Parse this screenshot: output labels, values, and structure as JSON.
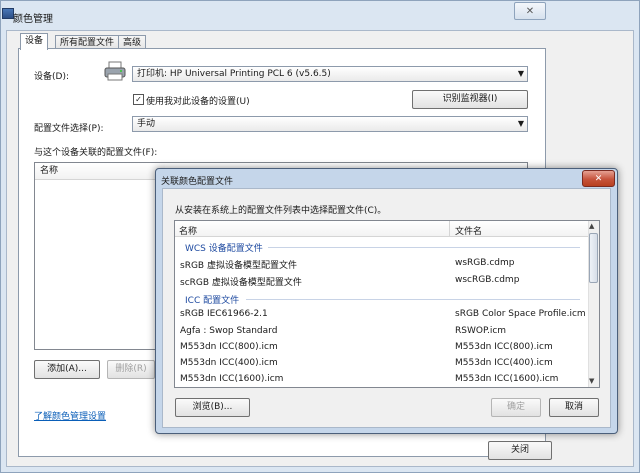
{
  "main": {
    "title": "颜色管理",
    "close_glyph": "✕",
    "tabs": [
      "设备",
      "所有配置文件",
      "高级"
    ],
    "device_label": "设备(D):",
    "device_value": "打印机: HP Universal Printing PCL 6 (v5.6.5)",
    "use_settings_checkbox": "使用我对此设备的设置(U)",
    "identify_button": "识别监视器(I)",
    "profile_selection_label": "配置文件选择(P):",
    "profile_selection_value": "手动",
    "associated_label": "与这个设备关联的配置文件(F):",
    "list_column_name": "名称",
    "add_button": "添加(A)...",
    "remove_button": "删除(R)",
    "learn_link": "了解颜色管理设置",
    "close_button": "关闭"
  },
  "dialog": {
    "title": "关联颜色配置文件",
    "close_glyph": "✕",
    "instruction": "从安装在系统上的配置文件列表中选择配置文件(C)。",
    "col_name": "名称",
    "col_file": "文件名",
    "wcs_group": "WCS 设备配置文件",
    "icc_group": "ICC 配置文件",
    "wcs_rows": [
      {
        "name": "sRGB 虚拟设备模型配置文件",
        "file": "wsRGB.cdmp"
      },
      {
        "name": "scRGB 虚拟设备模型配置文件",
        "file": "wscRGB.cdmp"
      }
    ],
    "icc_rows": [
      {
        "name": "sRGB IEC61966-2.1",
        "file": "sRGB Color Space Profile.icm"
      },
      {
        "name": "Agfa : Swop Standard",
        "file": "RSWOP.icm"
      },
      {
        "name": "M553dn ICC(800).icm",
        "file": "M553dn ICC(800).icm"
      },
      {
        "name": "M553dn ICC(400).icm",
        "file": "M553dn ICC(400).icm"
      },
      {
        "name": "M553dn ICC(1600).icm",
        "file": "M553dn ICC(1600).icm"
      }
    ],
    "browse_button": "浏览(B)...",
    "ok_button": "确定",
    "cancel_button": "取消"
  }
}
